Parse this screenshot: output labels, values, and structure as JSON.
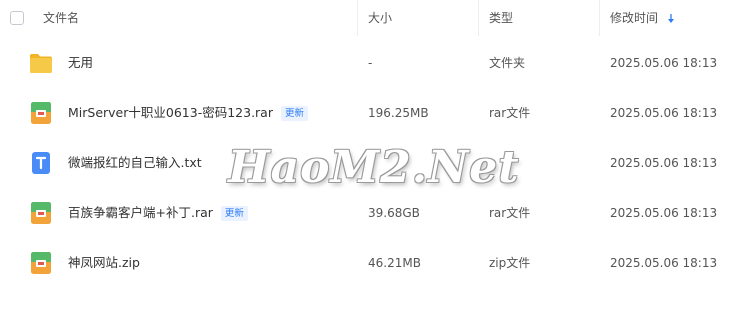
{
  "header": {
    "name_label": "文件名",
    "size_label": "大小",
    "type_label": "类型",
    "mtime_label": "修改时间"
  },
  "files": [
    {
      "name": "无用",
      "size": "-",
      "type": "文件夹",
      "mtime": "2025.05.06 18:13",
      "icon": "folder-icon",
      "badge": ""
    },
    {
      "name": "MirServer十职业0613-密码123.rar",
      "size": "196.25MB",
      "type": "rar文件",
      "mtime": "2025.05.06 18:13",
      "icon": "archive-icon",
      "badge": "更新"
    },
    {
      "name": "微端报红的自己输入.txt",
      "size": "",
      "type": "",
      "mtime": "2025.05.06 18:13",
      "icon": "text-file-icon",
      "badge": ""
    },
    {
      "name": "百族争霸客户端+补丁.rar",
      "size": "39.68GB",
      "type": "rar文件",
      "mtime": "2025.05.06 18:13",
      "icon": "archive-icon",
      "badge": "更新"
    },
    {
      "name": "神凤网站.zip",
      "size": "46.21MB",
      "type": "zip文件",
      "mtime": "2025.05.06 18:13",
      "icon": "archive-icon",
      "badge": ""
    }
  ],
  "watermark": "HaoM2.Net",
  "colors": {
    "accent": "#2f7df6",
    "folder": "#f7c33b",
    "archive_top": "#55b96a",
    "archive_bottom": "#f2a33a",
    "text_file": "#4a8cf7"
  }
}
